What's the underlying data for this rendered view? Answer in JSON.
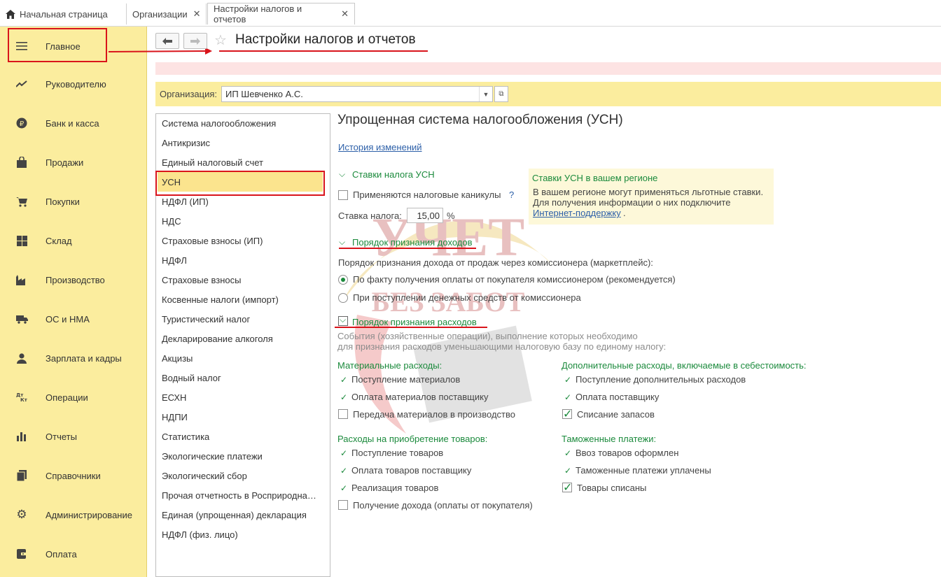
{
  "tabs": [
    {
      "label": "Начальная страница",
      "closable": false
    },
    {
      "label": "Организации",
      "closable": true
    },
    {
      "label": "Настройки налогов и отчетов",
      "closable": true
    }
  ],
  "sidebar": {
    "items": [
      {
        "label": "Главное",
        "icon": "menu-icon"
      },
      {
        "label": "Руководителю",
        "icon": "trend-icon"
      },
      {
        "label": "Банк и касса",
        "icon": "ruble-icon"
      },
      {
        "label": "Продажи",
        "icon": "bag-icon"
      },
      {
        "label": "Покупки",
        "icon": "cart-icon"
      },
      {
        "label": "Склад",
        "icon": "grid-icon"
      },
      {
        "label": "Производство",
        "icon": "factory-icon"
      },
      {
        "label": "ОС и НМА",
        "icon": "truck-icon"
      },
      {
        "label": "Зарплата и кадры",
        "icon": "person-icon"
      },
      {
        "label": "Операции",
        "icon": "dt-kt-icon"
      },
      {
        "label": "Отчеты",
        "icon": "bar-chart-icon"
      },
      {
        "label": "Справочники",
        "icon": "books-icon"
      },
      {
        "label": "Администрирование",
        "icon": "gear-icon"
      },
      {
        "label": "Оплата",
        "icon": "wallet-icon"
      }
    ]
  },
  "header": {
    "title": "Настройки налогов и отчетов",
    "org_label": "Организация:",
    "org_value": "ИП Шевченко А.С."
  },
  "nav": {
    "items": [
      "Система налогообложения",
      "Антикризис",
      "Единый налоговый счет",
      "УСН",
      "НДФЛ (ИП)",
      "НДС",
      "Страховые взносы (ИП)",
      "НДФЛ",
      "Страховые взносы",
      "Косвенные налоги (импорт)",
      "Туристический налог",
      "Декларирование алкоголя",
      "Акцизы",
      "Водный налог",
      "ЕСХН",
      "НДПИ",
      "Статистика",
      "Экологические платежи",
      "Экологический сбор",
      "Прочая отчетность в Росприродна…",
      "Единая (упрощенная) декларация",
      "НДФЛ (физ. лицо)"
    ],
    "selected": "УСН"
  },
  "content": {
    "heading": "Упрощенная система налогообложения (УСН)",
    "history_link": "История изменений",
    "rates_section": "Ставки налога УСН",
    "tax_holidays": "Применяются налоговые каникулы",
    "help_mark": "?",
    "rate_label": "Ставка налога:",
    "rate_value": "15,00",
    "rate_unit": "%",
    "info": {
      "title": "Ставки УСН в вашем регионе",
      "line1": "В вашем регионе могут применяться льготные ставки.",
      "line2": "Для получения информации о них подключите",
      "link": "Интернет-поддержку",
      "dot": "."
    },
    "income_section": "Порядок признания доходов",
    "income_question": "Порядок признания дохода от продаж через комиссионера (маркетплейс):",
    "income_opt1": "По факту получения оплаты от покупателя комиссионером (рекомендуется)",
    "income_opt2": "При поступлении денежных средств от комиссионера",
    "expense_section": "Порядок признания расходов",
    "expense_desc1": "События (хозяйственные операции), выполнение которых необходимо",
    "expense_desc2": "для признания расходов уменьшающими налоговую базу по единому налогу:",
    "material": {
      "title": "Материальные расходы:",
      "items": [
        "Поступление материалов",
        "Оплата материалов поставщику",
        "Передача материалов в производство"
      ]
    },
    "additional": {
      "title": "Дополнительные расходы, включаемые в себестоимость:",
      "items": [
        "Поступление дополнительных расходов",
        "Оплата поставщику",
        "Списание запасов"
      ]
    },
    "goods": {
      "title": "Расходы на приобретение товаров:",
      "items": [
        "Поступление товаров",
        "Оплата товаров поставщику",
        "Реализация товаров",
        "Получение дохода (оплаты от покупателя)"
      ]
    },
    "customs": {
      "title": "Таможенные платежи:",
      "items": [
        "Ввоз товаров оформлен",
        "Таможенные платежи уплачены",
        "Товары списаны"
      ]
    }
  },
  "watermark": {
    "line1": "УЧЕТ",
    "line2": "БЕЗ ЗАБОТ"
  },
  "colors": {
    "sidebar": "#fbed9e",
    "accent_green": "#1b8a3c",
    "annotation_red": "#d9141b",
    "link": "#2c5fa8"
  }
}
